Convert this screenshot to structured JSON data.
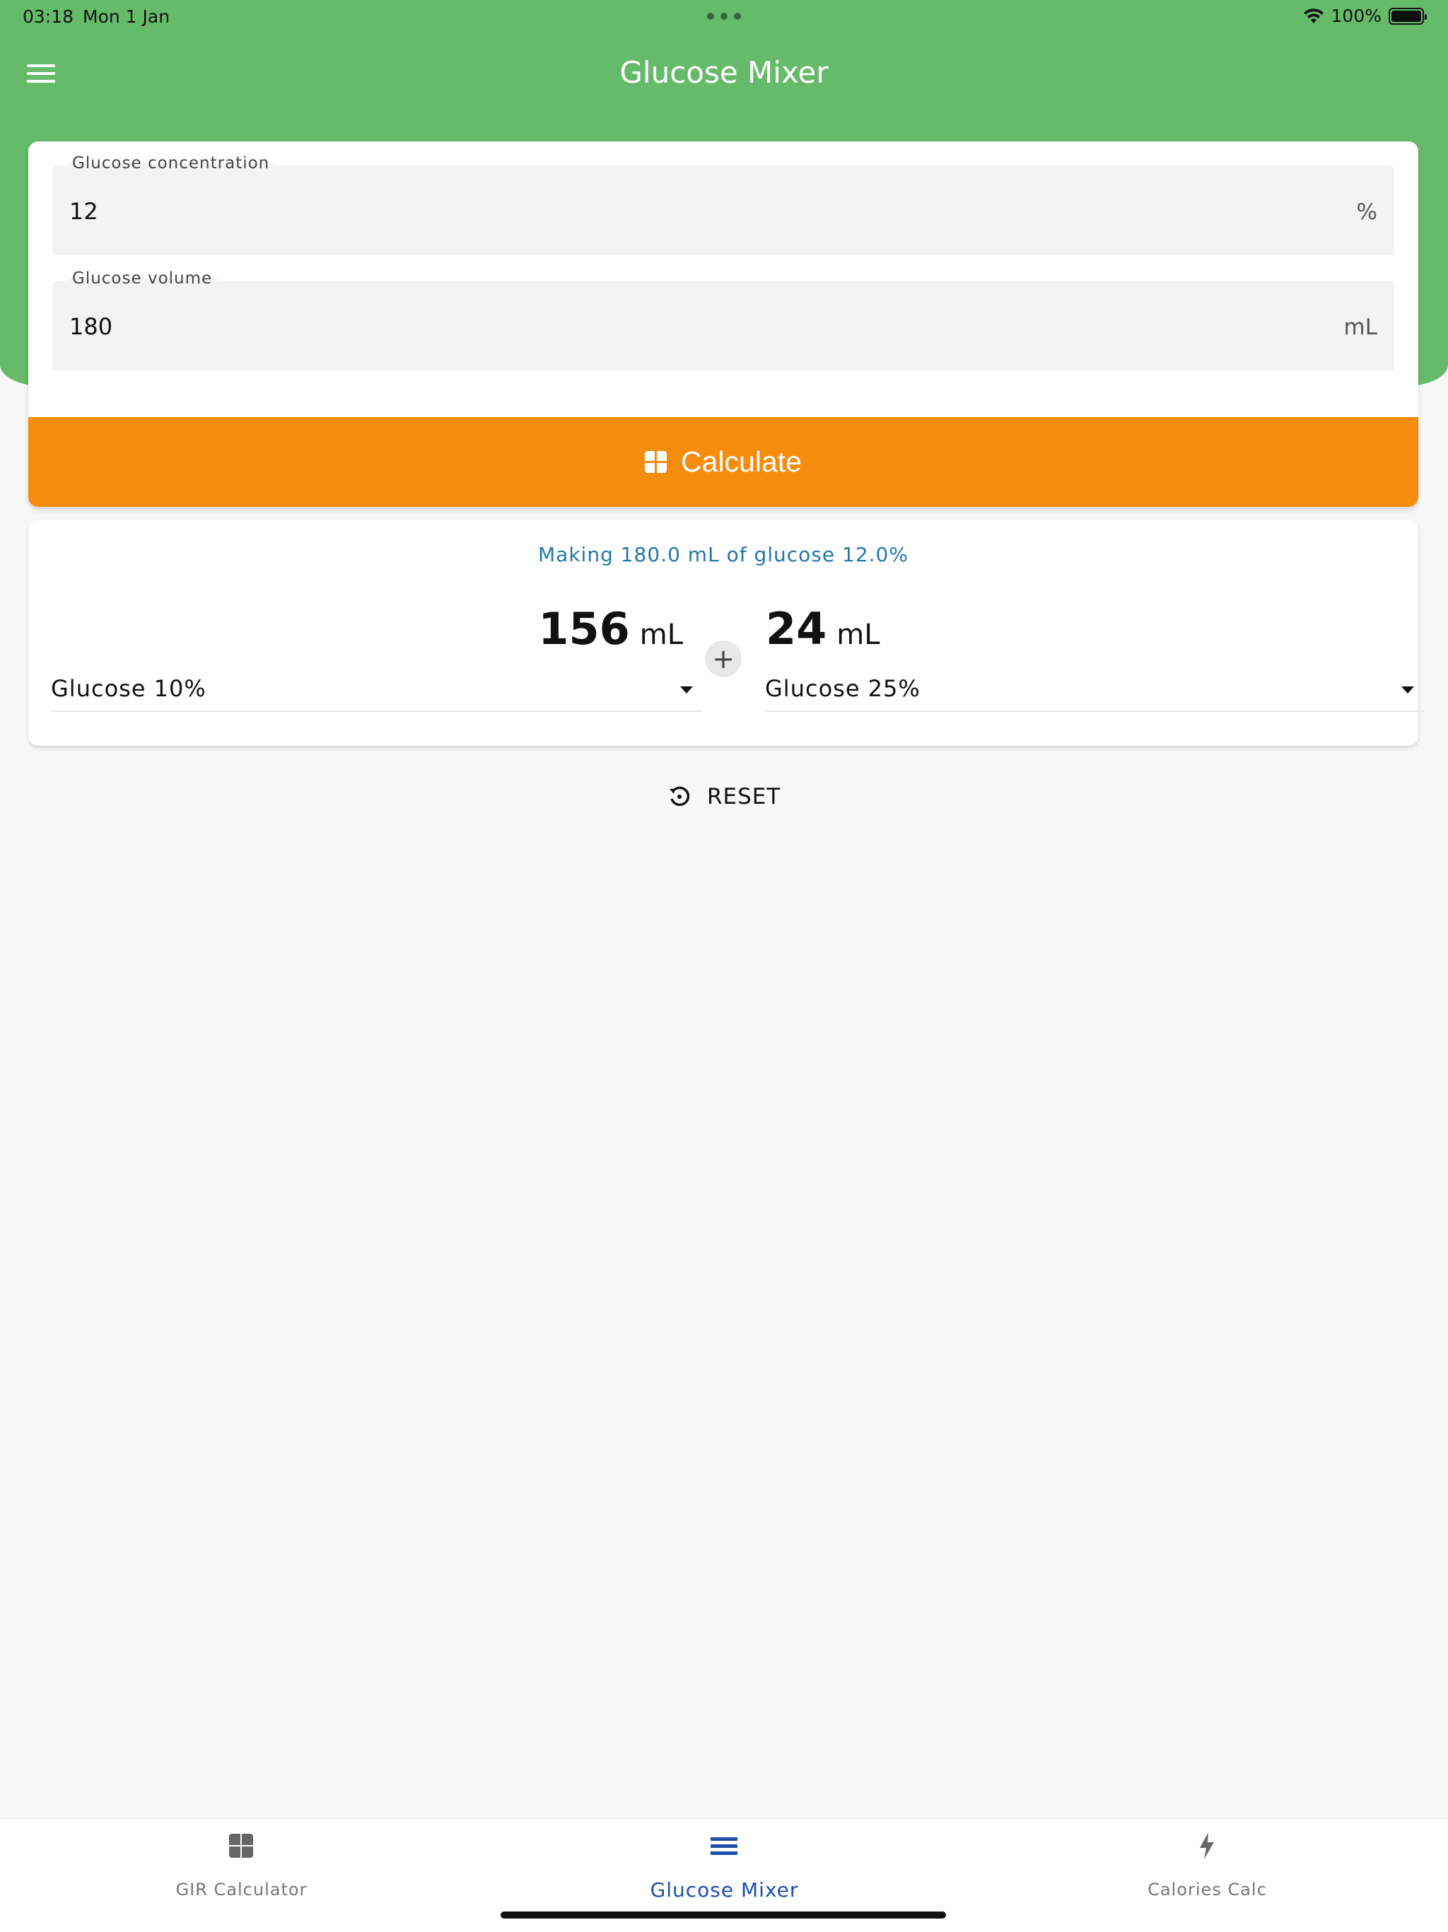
{
  "status_bar": {
    "time": "03:18",
    "date": "Mon 1 Jan",
    "battery": "100%",
    "battery_level": 1.0
  },
  "app_bar": {
    "title": "Glucose Mixer",
    "menu_icon": "hamburger-menu-icon"
  },
  "form": {
    "concentration": {
      "label": "Glucose concentration",
      "value": "12",
      "unit": "%"
    },
    "volume": {
      "label": "Glucose volume",
      "value": "180",
      "unit": "mL"
    },
    "calculate_label": "Calculate",
    "calculate_icon": "calculator-icon"
  },
  "result": {
    "summary": "Making 180.0 mL of glucose 12.0%",
    "left_amount": "156",
    "left_unit": "mL",
    "right_amount": "24",
    "right_unit": "mL",
    "plus": "+",
    "left_solution": "Glucose 10%",
    "right_solution": "Glucose 25%"
  },
  "reset": {
    "label": "RESET",
    "icon": "history-reset-icon"
  },
  "bottom_nav": {
    "items": [
      {
        "label": "GIR Calculator",
        "icon": "calculator-icon",
        "active": false
      },
      {
        "label": "Glucose Mixer",
        "icon": "list-icon",
        "active": true
      },
      {
        "label": "Calories Calc",
        "icon": "bolt-icon",
        "active": false
      }
    ]
  },
  "colors": {
    "header": "#66bb6a",
    "accent": "#f68c0e",
    "link": "#2477a8",
    "active_nav": "#1e4fa8"
  }
}
